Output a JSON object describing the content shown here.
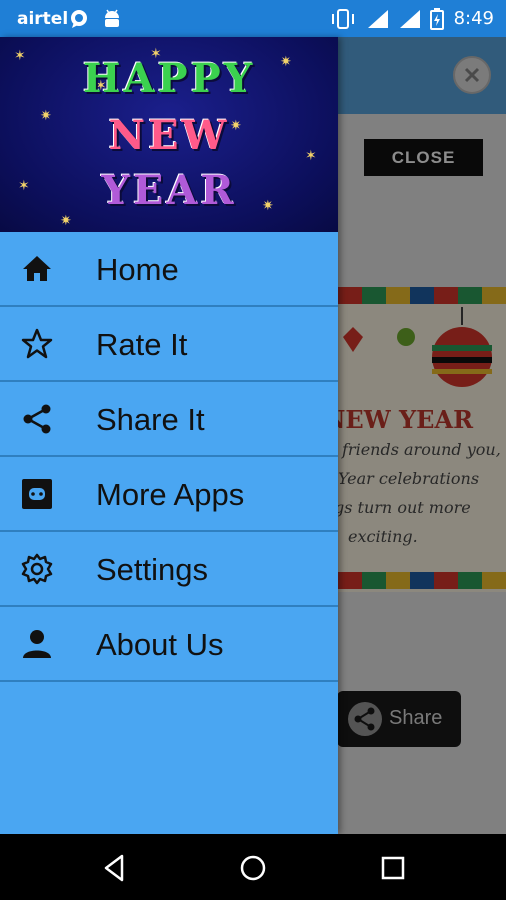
{
  "status_bar": {
    "carrier": "airtel",
    "time": "8:49",
    "icons": [
      "whatsapp-icon",
      "android-icon",
      "vibrate-icon",
      "signal-icon",
      "signal-icon",
      "battery-charging-icon"
    ]
  },
  "drawer": {
    "header": {
      "line1": "HAPPY",
      "line2": "NEW",
      "line3": "YEAR"
    },
    "items": [
      {
        "label": "Home",
        "icon": "home-icon"
      },
      {
        "label": "Rate It",
        "icon": "star-outline-icon"
      },
      {
        "label": "Share It",
        "icon": "share-icon"
      },
      {
        "label": "More Apps",
        "icon": "store-icon"
      },
      {
        "label": "Settings",
        "icon": "gear-icon"
      },
      {
        "label": "About Us",
        "icon": "person-icon"
      }
    ]
  },
  "background": {
    "close_label": "CLOSE",
    "card_title": "Y NEW YEAR",
    "card_lines": [
      "friends around you,",
      "Year celebrations",
      "gs turn out more",
      "exciting."
    ],
    "share_label": "Share"
  },
  "navigation_bar": {
    "icons": [
      "back-icon",
      "home-circle-icon",
      "recents-icon"
    ]
  },
  "colors": {
    "status_bar": "#1f7fd6",
    "drawer_bg": "#4aa6f2",
    "divider": "#2f7fc0",
    "header_bg": "#0c0f5c"
  }
}
